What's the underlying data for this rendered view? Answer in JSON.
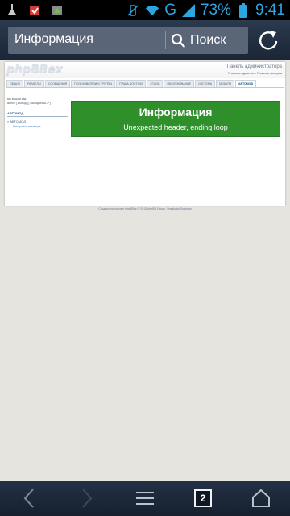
{
  "status_bar": {
    "battery_percent": "73%",
    "network_type": "G",
    "time": "9:41",
    "notification_icons": [
      "cleaner-icon",
      "shopping-bag-icon",
      "android-icon"
    ],
    "system_icons": [
      "vibrate-off-icon",
      "wifi-icon",
      "signal-icon",
      "battery-icon"
    ]
  },
  "browser": {
    "page_title": "Информация",
    "search_label": "Поиск",
    "tabs_count": "2"
  },
  "site": {
    "logo_text": "phpBBex",
    "admin_title": "Панель администратора",
    "admin_links": "Главная админки • Главная форума",
    "tabs": [
      {
        "label": "ОБЩИЕ"
      },
      {
        "label": "РАЗДЕЛЫ"
      },
      {
        "label": "СООБЩЕНИЯ"
      },
      {
        "label": "ПОЛЬЗОВАТЕЛИ И ГРУППЫ"
      },
      {
        "label": "ПРАВА ДОСТУПА"
      },
      {
        "label": "СТИЛИ"
      },
      {
        "label": "ОБСЛУЖИВАНИЕ"
      },
      {
        "label": "СИСТЕМА"
      },
      {
        "label": "МОДУЛИ"
      },
      {
        "label": "АВТОМОД"
      }
    ],
    "sidebar": {
      "logged_in_as": "Вы вошли как:",
      "user_line": "admin [ Выход ] [ Выход из АСР ]",
      "section_title": "АВТОМОД",
      "item": "» АВТОМОД",
      "subitem": "Настройки автомода"
    },
    "notice": {
      "heading": "Информация",
      "message": "Unexpected header, ending loop"
    },
    "footer": "Создано на основе phpBBex © 2013 phpBB Group, Vegalogic Software"
  },
  "colors": {
    "notice_green": "#2f8f2b",
    "status_blue": "#2ba6e1",
    "action_bar": "#243145"
  }
}
